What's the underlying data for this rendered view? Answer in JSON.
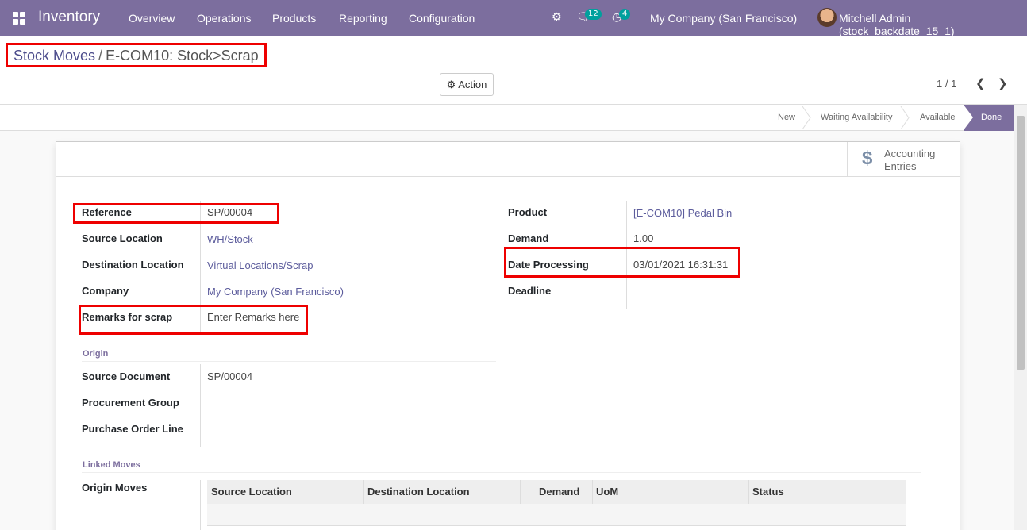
{
  "navbar": {
    "app_name": "Inventory",
    "menu": [
      "Overview",
      "Operations",
      "Products",
      "Reporting",
      "Configuration"
    ],
    "messages_count": "12",
    "activities_count": "4",
    "company": "My Company (San Francisco)",
    "user": "Mitchell Admin (stock_backdate_15_1)"
  },
  "breadcrumb": {
    "parent": "Stock Moves",
    "separator": "/",
    "current": "E-COM10: Stock>Scrap"
  },
  "toolbar": {
    "action_label": "Action",
    "pager": "1 / 1"
  },
  "statusbar": {
    "stages": [
      "New",
      "Waiting Availability",
      "Available",
      "Done"
    ],
    "active": "Done"
  },
  "smart_button": {
    "line1": "Accounting",
    "line2": "Entries"
  },
  "left_fields": {
    "reference_label": "Reference",
    "reference": "SP/00004",
    "source_location_label": "Source Location",
    "source_location": "WH/Stock",
    "destination_location_label": "Destination Location",
    "destination_location": "Virtual Locations/Scrap",
    "company_label": "Company",
    "company": "My Company (San Francisco)",
    "remarks_label": "Remarks for scrap",
    "remarks": "Enter Remarks here"
  },
  "right_fields": {
    "product_label": "Product",
    "product": "[E-COM10] Pedal Bin",
    "demand_label": "Demand",
    "demand": "1.00",
    "date_processing_label": "Date Processing",
    "date_processing": "03/01/2021 16:31:31",
    "deadline_label": "Deadline",
    "deadline": ""
  },
  "origin": {
    "title": "Origin",
    "source_document_label": "Source Document",
    "source_document": "SP/00004",
    "procurement_group_label": "Procurement Group",
    "purchase_order_line_label": "Purchase Order Line"
  },
  "linked_moves": {
    "title": "Linked Moves",
    "origin_moves_label": "Origin Moves",
    "columns": [
      "Source Location",
      "Destination Location",
      "Demand",
      "UoM",
      "Status"
    ]
  },
  "colors": {
    "navbar": "#7c6e9e",
    "highlight": "#e00000",
    "link": "#5c5c9c"
  }
}
